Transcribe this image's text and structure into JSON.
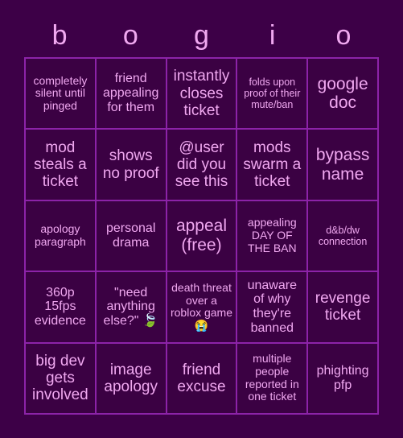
{
  "card": {
    "header_letters": [
      "b",
      "o",
      "g",
      "i",
      "o"
    ],
    "colors": {
      "background": "#3d0047",
      "cell_background": "#3b0143",
      "grid_line": "#8c23a8",
      "text": "#f0a8f0"
    },
    "rows": [
      [
        {
          "text": "completely silent until pinged",
          "size": "sm"
        },
        {
          "text": "friend appealing for them",
          "size": "md"
        },
        {
          "text": "instantly closes ticket",
          "size": "lg"
        },
        {
          "text": "folds upon proof of their mute/ban",
          "size": "xs"
        },
        {
          "text": "google doc",
          "size": "xl"
        }
      ],
      [
        {
          "text": "mod steals a ticket",
          "size": "lg"
        },
        {
          "text": "shows no proof",
          "size": "lg"
        },
        {
          "text": "@user did you see this",
          "size": "lg"
        },
        {
          "text": "mods swarm a ticket",
          "size": "lg"
        },
        {
          "text": "bypass name",
          "size": "xl"
        }
      ],
      [
        {
          "text": "apology paragraph",
          "size": "sm"
        },
        {
          "text": "personal drama",
          "size": "md"
        },
        {
          "text": "appeal (free)",
          "size": "xl"
        },
        {
          "text": "appealing DAY OF THE BAN",
          "size": "sm"
        },
        {
          "text": "d&b/dw connection",
          "size": "xs"
        }
      ],
      [
        {
          "text": "360p 15fps evidence",
          "size": "md"
        },
        {
          "text": "\"need anything else?\" 🍃",
          "size": "md"
        },
        {
          "text": "death threat over a roblox game 😭",
          "size": "sm"
        },
        {
          "text": "unaware of why they're banned",
          "size": "md"
        },
        {
          "text": "revenge ticket",
          "size": "lg"
        }
      ],
      [
        {
          "text": "big dev gets involved",
          "size": "lg"
        },
        {
          "text": "image apology",
          "size": "lg"
        },
        {
          "text": "friend excuse",
          "size": "lg"
        },
        {
          "text": "multiple people reported in one ticket",
          "size": "sm"
        },
        {
          "text": "phighting pfp",
          "size": "md"
        }
      ]
    ]
  }
}
